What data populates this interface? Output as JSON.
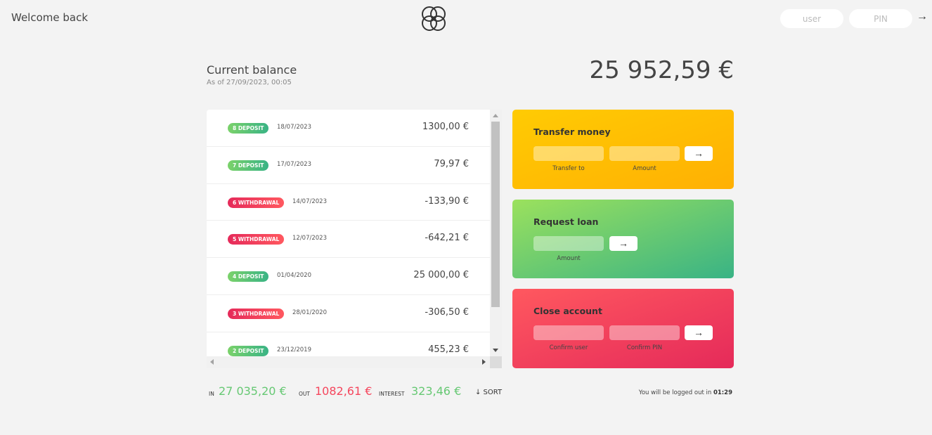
{
  "nav": {
    "welcome": "Welcome back",
    "user_placeholder": "user",
    "pin_placeholder": "PIN",
    "login_arrow": "→"
  },
  "balance": {
    "label": "Current balance",
    "date": "As of 27/09/2023, 00:05",
    "value": "25 952,59 €"
  },
  "movements": [
    {
      "badge": "8 DEPOSIT",
      "type": "deposit",
      "date": "18/07/2023",
      "value": "1300,00 €"
    },
    {
      "badge": "7 DEPOSIT",
      "type": "deposit",
      "date": "17/07/2023",
      "value": "79,97 €"
    },
    {
      "badge": "6 WITHDRAWAL",
      "type": "withdrawal",
      "date": "14/07/2023",
      "value": "-133,90 €"
    },
    {
      "badge": "5 WITHDRAWAL",
      "type": "withdrawal",
      "date": "12/07/2023",
      "value": "-642,21 €"
    },
    {
      "badge": "4 DEPOSIT",
      "type": "deposit",
      "date": "01/04/2020",
      "value": "25 000,00 €"
    },
    {
      "badge": "3 WITHDRAWAL",
      "type": "withdrawal",
      "date": "28/01/2020",
      "value": "-306,50 €"
    },
    {
      "badge": "2 DEPOSIT",
      "type": "deposit",
      "date": "23/12/2019",
      "value": "455,23 €"
    }
  ],
  "operations": {
    "transfer": {
      "title": "Transfer money",
      "label_to": "Transfer to",
      "label_amount": "Amount",
      "button": "→"
    },
    "loan": {
      "title": "Request loan",
      "label_amount": "Amount",
      "button": "→"
    },
    "close": {
      "title": "Close account",
      "label_user": "Confirm user",
      "label_pin": "Confirm PIN",
      "button": "→"
    }
  },
  "summary": {
    "in_label": "In",
    "in_value": "27 035,20 €",
    "out_label": "Out",
    "out_value": "1082,61 €",
    "interest_label": "Interest",
    "interest_value": "323,46 €",
    "sort_label": "↓ SORT"
  },
  "logout": {
    "text": "You will be logged out in ",
    "timer": "01:29"
  },
  "colors": {
    "deposit": "#39b385",
    "withdrawal": "#e52a5a",
    "transfer": "#ffb003",
    "loan": "#9be15d",
    "close": "#ff585f"
  }
}
